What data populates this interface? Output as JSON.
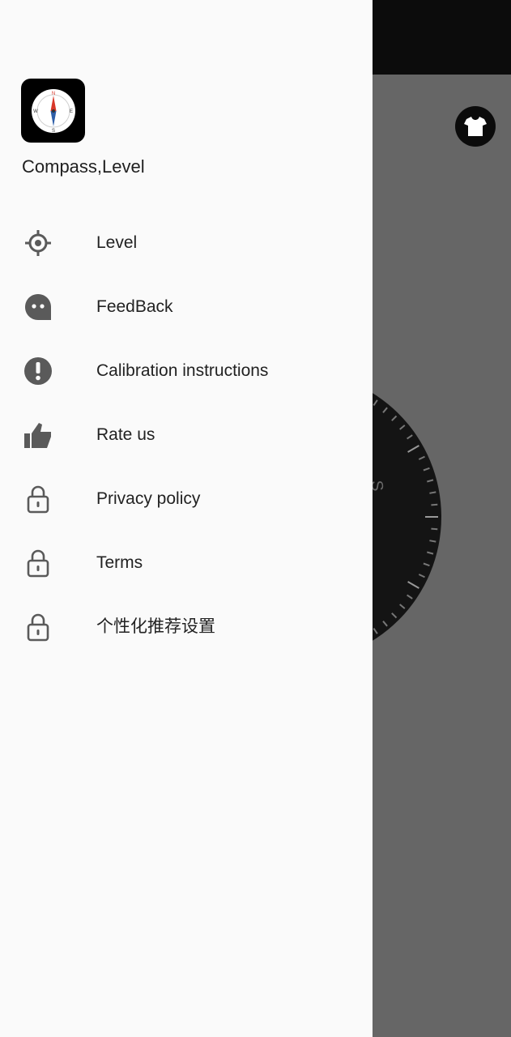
{
  "app": {
    "name": "Compass,Level"
  },
  "logo": {
    "letters": [
      "N",
      "E",
      "S",
      "W"
    ]
  },
  "menu": {
    "items": [
      {
        "label": "Level",
        "icon": "crosshair-icon"
      },
      {
        "label": "FeedBack",
        "icon": "feedback-icon"
      },
      {
        "label": "Calibration instructions",
        "icon": "exclamation-icon"
      },
      {
        "label": "Rate us",
        "icon": "thumbs-up-icon"
      },
      {
        "label": "Privacy policy",
        "icon": "lock-icon"
      },
      {
        "label": "Terms",
        "icon": "lock-icon"
      },
      {
        "label": "个性化推荐设置",
        "icon": "lock-icon"
      }
    ]
  },
  "background": {
    "dial_letter": "S",
    "theme_icon": "shirt-icon"
  },
  "colors": {
    "drawer": "#fafafa",
    "scrim": "#666666",
    "status_bar": "#0c0c0c",
    "icon_gray": "#555555",
    "text": "#222222"
  }
}
